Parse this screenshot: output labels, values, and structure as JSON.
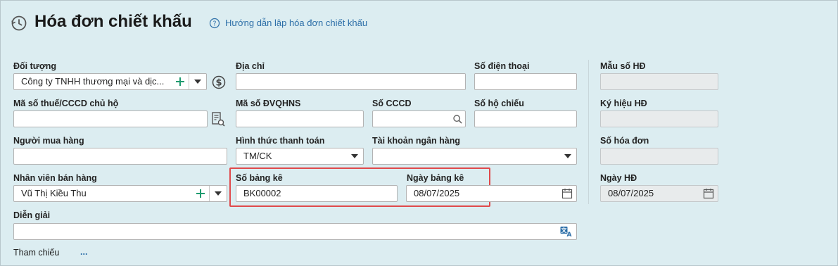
{
  "header": {
    "title": "Hóa đơn chiết khấu",
    "help_link": "Hướng dẫn lập hóa đơn chiết khấu",
    "history_icon": "history-clock-icon",
    "help_icon": "question-circle-icon"
  },
  "form": {
    "doi_tuong": {
      "label": "Đối tượng",
      "value": "Công ty TNHH thương mại và dịc..."
    },
    "dia_chi": {
      "label": "Địa chỉ",
      "value": ""
    },
    "so_dien_thoai": {
      "label": "Số điện thoại",
      "value": ""
    },
    "ma_so_thue": {
      "label": "Mã số thuế/CCCD chủ hộ",
      "value": ""
    },
    "ma_so_dvqhns": {
      "label": "Mã số ĐVQHNS",
      "value": ""
    },
    "so_cccd": {
      "label": "Số CCCD",
      "value": ""
    },
    "so_ho_chieu": {
      "label": "Số hộ chiếu",
      "value": ""
    },
    "nguoi_mua_hang": {
      "label": "Người mua hàng",
      "value": ""
    },
    "hinh_thuc_thanh_toan": {
      "label": "Hình thức thanh toán",
      "value": "TM/CK"
    },
    "tai_khoan_ngan_hang": {
      "label": "Tài khoản ngân hàng",
      "value": ""
    },
    "nhan_vien_ban_hang": {
      "label": "Nhân viên bán hàng",
      "value": "Vũ Thị Kiều Thu"
    },
    "so_bang_ke": {
      "label": "Số bảng kê",
      "value": "BK00002"
    },
    "ngay_bang_ke": {
      "label": "Ngày bảng kê",
      "value": "08/07/2025"
    },
    "dien_giai": {
      "label": "Diễn giải",
      "value": ""
    },
    "tham_chieu": {
      "label": "Tham chiếu",
      "link": "..."
    }
  },
  "invoice": {
    "mau_so": {
      "label": "Mẫu số HĐ",
      "value": ""
    },
    "ky_hieu": {
      "label": "Ký hiệu HĐ",
      "value": ""
    },
    "so_hoa_don": {
      "label": "Số hóa đơn",
      "value": ""
    },
    "ngay_hd": {
      "label": "Ngày HĐ",
      "value": "08/07/2025"
    }
  },
  "colors": {
    "background": "#dcedf1",
    "accent_green": "#1f9b6f",
    "link_blue": "#2d6fa8",
    "highlight_red": "#e0494b"
  }
}
